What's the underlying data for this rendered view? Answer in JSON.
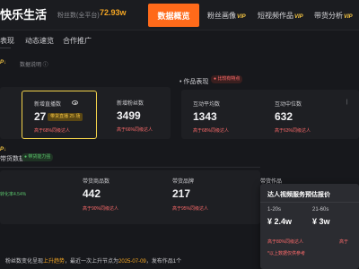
{
  "header": {
    "brand": "快乐生活",
    "fan_label": "粉丝数(全平台)",
    "fan_value": "72.93w",
    "nav": {
      "active": "数据概览",
      "fans": "粉丝画像",
      "video": "短视频作品",
      "goods": "带货分析",
      "vip": "VIP"
    }
  },
  "subnav": {
    "tab1": "表现",
    "tab2": "动态速览",
    "tab3": "合作推广"
  },
  "hint_vip": "P↓",
  "data_desc": "数据说明",
  "overview": {
    "new_live": {
      "label": "新增直播数",
      "value": "27",
      "badge": "带货直播 25 场",
      "note": "高于68%同级达人"
    },
    "new_fans": {
      "label": "新增粉丝数",
      "value": "3499",
      "note": "高于66%同级达人"
    }
  },
  "works": {
    "title": "作品表现",
    "pill": "比较有特点",
    "avg_label": "互动平均数",
    "avg_value": "1343",
    "avg_note": "高于68%同级达人",
    "mid_label": "互动中位数",
    "mid_value": "632",
    "mid_note": "高于63%同级达人"
  },
  "commerce": {
    "title": "带货数据",
    "pill": "带货能力强",
    "conv_label": "转化率",
    "conv_value": "4.54%",
    "goods_label": "带货商品数",
    "goods_value": "442",
    "goods_note": "高于90%同级达人",
    "brand_label": "带货品牌",
    "brand_value": "217",
    "brand_note": "高于95%同级达人",
    "works_label": "带货作品"
  },
  "popup": {
    "title": "达人视频服务预估报价",
    "col1_range": "1-20s",
    "col1_price": "¥ 2.4w",
    "col1_note": "高于80%同级达人",
    "col2_range": "21-60s",
    "col2_price": "¥ 3w",
    "col2_note": "高于",
    "hint": "*以上数据仅供参考"
  },
  "footer": {
    "prefix": "粉丝数变化呈现",
    "trend": "上升趋势",
    "mid": "，最近一次上升节点为",
    "date": "2025-07-09",
    "suffix": "，发布作品1个"
  }
}
